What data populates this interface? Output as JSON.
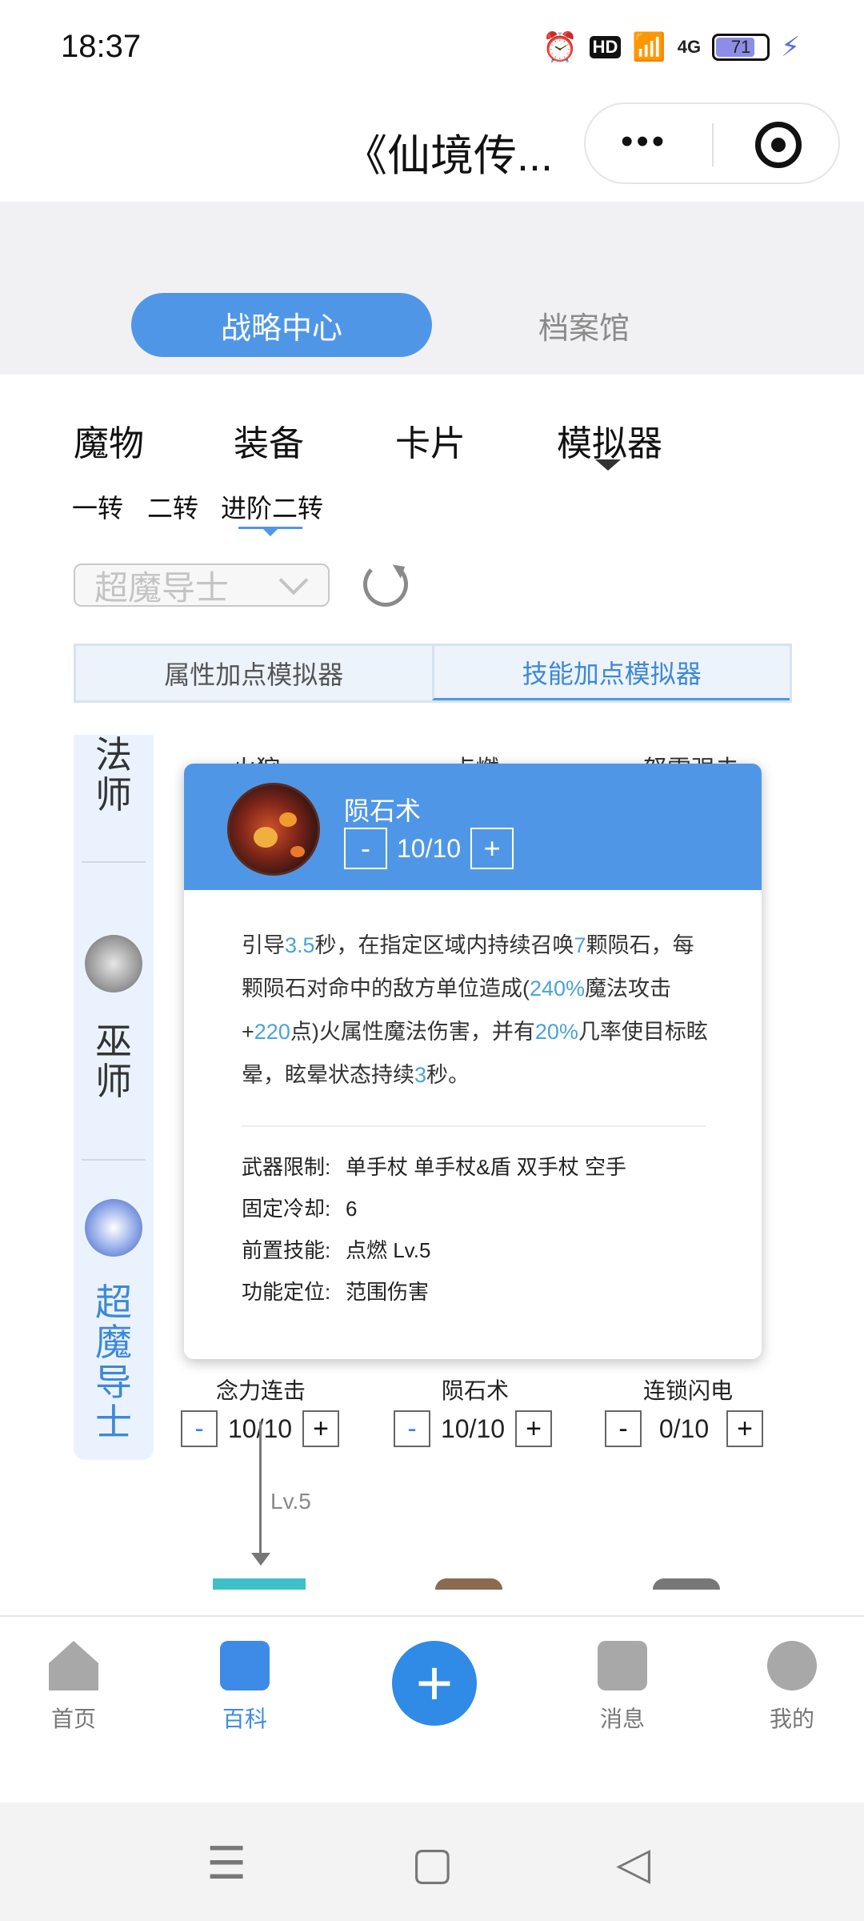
{
  "status_bar": {
    "time": "18:37",
    "battery": "71",
    "hd": "HD",
    "network": "4G"
  },
  "title_bar": {
    "title": "《仙境传..."
  },
  "top_tabs": [
    {
      "label": "战略中心",
      "active": true
    },
    {
      "label": "档案馆",
      "active": false
    }
  ],
  "categories": [
    "魔物",
    "装备",
    "卡片",
    "模拟器"
  ],
  "subtabs": [
    "一转",
    "二转",
    "进阶二转"
  ],
  "class_select": {
    "value": "超魔导士"
  },
  "sim_tabs": [
    "属性加点模拟器",
    "技能加点模拟器"
  ],
  "class_column": [
    "法师",
    "巫师",
    "超魔导士"
  ],
  "partial_skills_top": [
    "火狩",
    "点燃",
    "怒雷强击"
  ],
  "popup": {
    "skill_name": "陨石术",
    "level": "10/10",
    "minus": "-",
    "plus": "+",
    "desc_parts": [
      "引导",
      "3.5",
      "秒，在指定区域内持续召唤",
      "7",
      "颗陨石，每颗陨石对命中的敌方单位造成(",
      "240%",
      "魔法攻击+",
      "220",
      "点)火属性魔法伤害，并有",
      "20%",
      "几率使目标眩晕，眩晕状态持续",
      "3",
      "秒。"
    ],
    "info": [
      {
        "key": "武器限制:",
        "value": "单手杖 单手杖&盾 双手杖 空手"
      },
      {
        "key": "固定冷却:",
        "value": "6"
      },
      {
        "key": "前置技能:",
        "value": "点燃 Lv.5"
      },
      {
        "key": "功能定位:",
        "value": "范围伤害"
      }
    ]
  },
  "skills_row": [
    {
      "name": "念力连击",
      "value": "10/10"
    },
    {
      "name": "陨石术",
      "value": "10/10"
    },
    {
      "name": "连锁闪电",
      "value": "0/10"
    }
  ],
  "prereq_label": "Lv.5",
  "bottom_nav": [
    {
      "label": "首页",
      "icon": "home-icon"
    },
    {
      "label": "百科",
      "icon": "book-icon"
    },
    {
      "label": "消息",
      "icon": "message-icon"
    },
    {
      "label": "我的",
      "icon": "profile-icon"
    }
  ],
  "colors": {
    "accent": "#4f97e6",
    "highlight": "#4aa3d8"
  }
}
